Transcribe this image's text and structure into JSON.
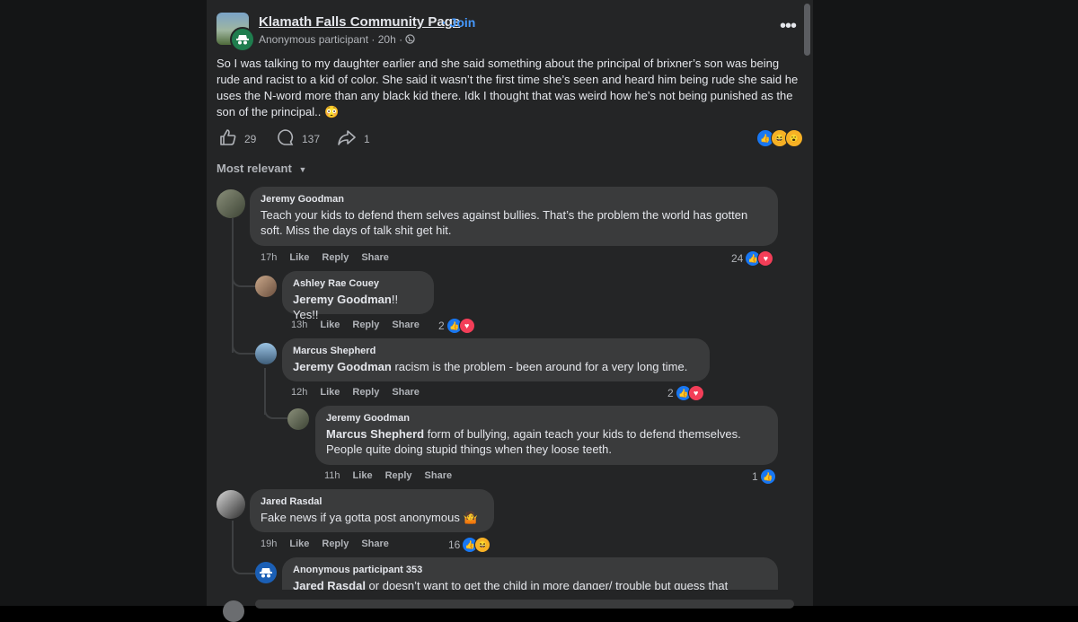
{
  "post": {
    "group_name": "Klamath Falls Community Page",
    "join_label": "· Join",
    "meta": "Anonymous participant · 20h · ",
    "more_icon": "•••",
    "body": "So I was talking to my daughter earlier and she said something about the principal of brixner’s son was being rude and racist to a kid of color. She said it wasn’t the first time she’s seen and heard him being rude she said he uses the N-word more than any black kid there. Idk I thought that was weird how he’s not being punished as the son of the principal.. ",
    "body_emoji": "😳",
    "likes": "29",
    "comments": "137",
    "shares": "1"
  },
  "sort_label": "Most relevant",
  "comments": [
    {
      "name": "Jeremy Goodman",
      "text_line1": "Teach your kids to defend them selves against bullies. That’s the problem the world has gotten",
      "text_line2": "soft. Miss the days of talk shit get hit.",
      "time": "17h",
      "like": "Like",
      "reply": "Reply",
      "share": "Share",
      "count": "24"
    },
    {
      "name": "Ashley Rae Couey",
      "mention": "Jeremy Goodman",
      "text": "!! Yes!!",
      "time": "13h",
      "like": "Like",
      "reply": "Reply",
      "share": "Share",
      "count": "2"
    },
    {
      "name": "Marcus Shepherd",
      "mention": "Jeremy Goodman",
      "text": " racism is the problem - been around for a very long time.",
      "time": "12h",
      "like": "Like",
      "reply": "Reply",
      "share": "Share",
      "count": "2"
    },
    {
      "name": "Jeremy Goodman",
      "mention": "Marcus Shepherd",
      "text_line1": " form of bullying, again teach your kids to defend themselves.",
      "text_line2": "People quite doing stupid things when they loose teeth.",
      "time": "11h",
      "like": "Like",
      "reply": "Reply",
      "share": "Share",
      "count": "1"
    },
    {
      "name": "Jared Rasdal",
      "text": "Fake news if ya gotta post anonymous ",
      "emoji": "🤷",
      "time": "19h",
      "like": "Like",
      "reply": "Reply",
      "share": "Share",
      "count": "16"
    },
    {
      "name": "Anonymous participant 353",
      "mention": "Jared Rasdal",
      "text": " or doesn’t want to get the child in more danger/ trouble but guess that"
    }
  ],
  "colors": {
    "accent": "#4599ff",
    "like": "#1877f2",
    "love": "#f33e58",
    "haha": "#f7b125",
    "surface": "#242526",
    "bubble": "#3a3b3c"
  },
  "icons": [
    "thumbs-up-icon",
    "comment-icon",
    "share-icon",
    "globe-icon",
    "anonymous-icon",
    "chevron-down-icon",
    "more-icon"
  ]
}
